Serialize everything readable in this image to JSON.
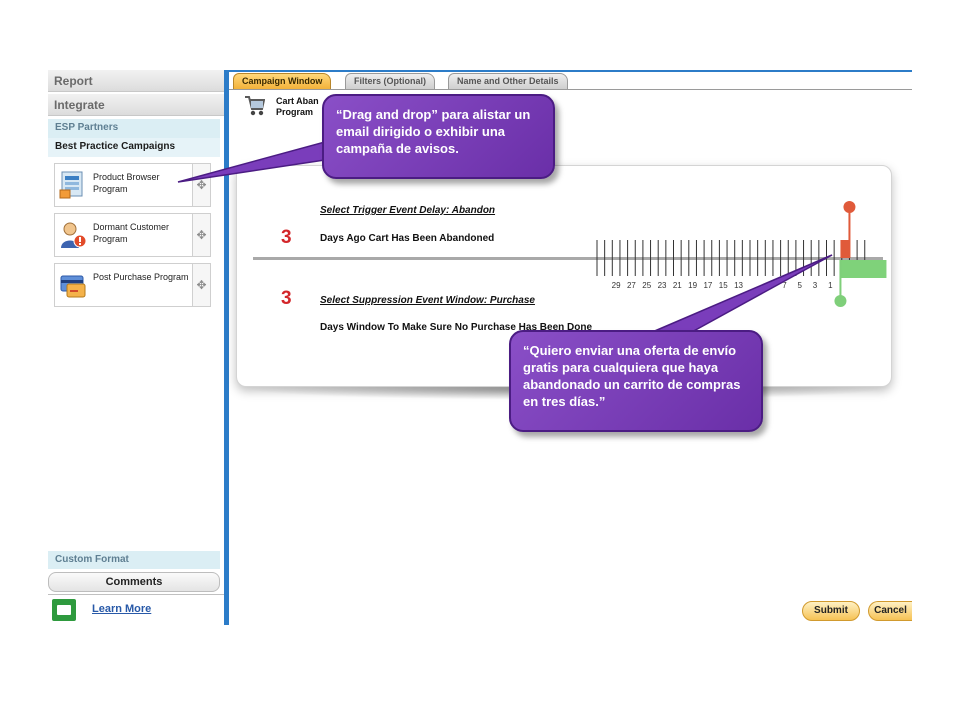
{
  "sidebar": {
    "sections": [
      "Report",
      "Integrate"
    ],
    "subheads": [
      "ESP Partners",
      "Best Practice Campaigns"
    ],
    "programs": [
      {
        "label": "Product Browser Program",
        "icon": "product-browser-icon"
      },
      {
        "label": "Dormant Customer Program",
        "icon": "dormant-customer-icon"
      },
      {
        "label": "Post Purchase Program",
        "icon": "post-purchase-icon"
      }
    ],
    "drag_glyph": "✥",
    "custom_format": "Custom Format",
    "comments": "Comments",
    "learn_more": "Learn More"
  },
  "tabs": [
    {
      "label": "Campaign Window",
      "active": true
    },
    {
      "label": "Filters (Optional)",
      "active": false
    },
    {
      "label": "Name and Other Details",
      "active": false
    }
  ],
  "campaign": {
    "title_line1": "Cart Aban",
    "title_line2": "Program"
  },
  "trigger": {
    "number": "3",
    "label": "Select Trigger Event Delay: Abandon",
    "description": "Days Ago Cart Has Been Abandoned"
  },
  "suppression": {
    "number": "3",
    "label": "Select Suppression Event Window: Purchase",
    "description": "Days Window To Make Sure No Purchase Has Been Done"
  },
  "timeline": {
    "tick_labels": [
      "29",
      "27",
      "25",
      "23",
      "21",
      "19",
      "17",
      "15",
      "13",
      "",
      "",
      "7",
      "5",
      "3",
      "1"
    ],
    "colors": {
      "track": "#a9a9a9",
      "trigger": "#e05a3a",
      "suppression": "#7fd27a",
      "suppression_dot": "#7fcf7a"
    }
  },
  "callouts": {
    "drag": "“Drag and drop” para alistar un email dirigido o exhibir una campaña de avisos.",
    "offer": "“Quiero enviar una oferta de envío gratis para cualquiera que haya abandonado un carrito de compras en tres días.”"
  },
  "actions": {
    "submit": "Submit",
    "cancel": "Cancel"
  }
}
